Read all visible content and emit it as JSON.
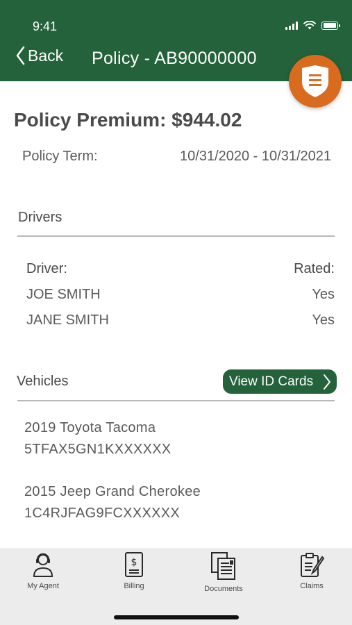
{
  "status_bar": {
    "time": "9:41"
  },
  "nav": {
    "back_label": "Back",
    "title": "Policy - AB90000000"
  },
  "policy": {
    "premium": "Policy Premium: $944.02",
    "term_label": "Policy Term:",
    "term_value": "10/31/2020 - 10/31/2021"
  },
  "drivers": {
    "section_title": "Drivers",
    "header_driver": "Driver:",
    "header_rated": "Rated:",
    "rows": [
      {
        "name": "JOE SMITH",
        "rated": "Yes"
      },
      {
        "name": "JANE SMITH",
        "rated": "Yes"
      }
    ]
  },
  "vehicles": {
    "section_title": "Vehicles",
    "view_id_cards_label": "View ID Cards",
    "items": [
      {
        "name": "2019 Toyota Tacoma",
        "vin": "5TFAX5GN1KXXXXXX"
      },
      {
        "name": "2015 Jeep Grand Cherokee",
        "vin": "1C4RJFAG9FCXXXXXX"
      }
    ]
  },
  "tabbar": {
    "tabs": [
      {
        "label": "My Agent",
        "icon": "agent-icon"
      },
      {
        "label": "Billing",
        "icon": "billing-icon"
      },
      {
        "label": "Documents",
        "icon": "documents-icon"
      },
      {
        "label": "Claims",
        "icon": "claims-icon"
      }
    ]
  },
  "colors": {
    "brand_green": "#23623a",
    "badge_orange": "#d96b1f"
  }
}
